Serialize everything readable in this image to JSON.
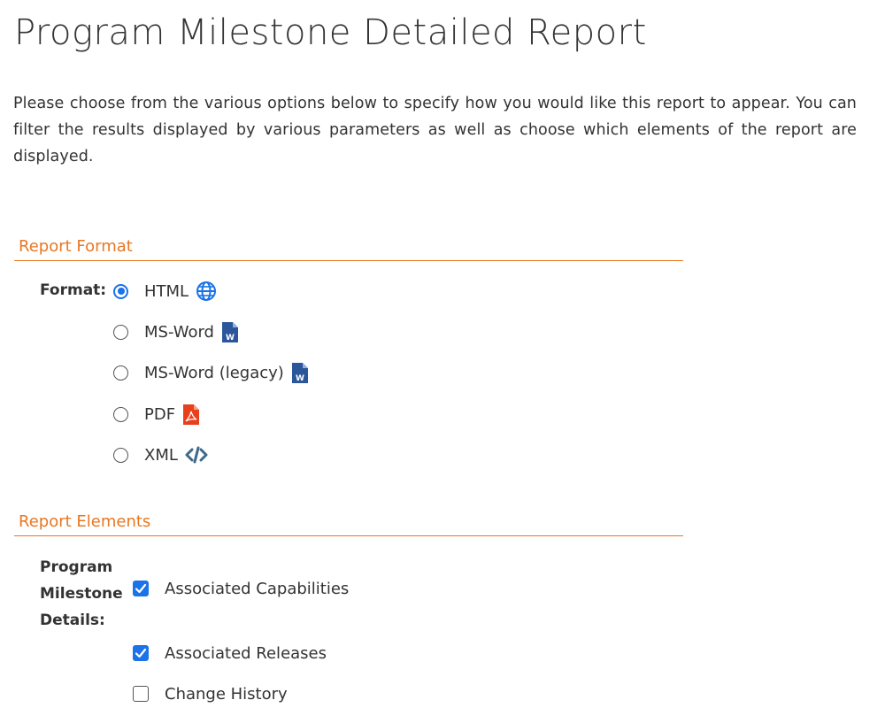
{
  "page_title": "Program Milestone Detailed Report",
  "intro": "Please choose from the various options below to specify how you would like this report to appear. You can filter the results displayed by various parameters as well as choose which elements of the report are displayed.",
  "report_format": {
    "section_title": "Report Format",
    "label": "Format:",
    "options": [
      {
        "label": "HTML",
        "icon": "globe-icon",
        "selected": true
      },
      {
        "label": "MS-Word",
        "icon": "word-icon",
        "selected": false
      },
      {
        "label": "MS-Word (legacy)",
        "icon": "word-icon",
        "selected": false
      },
      {
        "label": "PDF",
        "icon": "pdf-icon",
        "selected": false
      },
      {
        "label": "XML",
        "icon": "code-icon",
        "selected": false
      }
    ]
  },
  "report_elements": {
    "section_title": "Report Elements",
    "label_line1": "Program",
    "label_line2": "Milestone",
    "label_line3": "Details:",
    "items": [
      {
        "label": "Associated Capabilities",
        "checked": true
      },
      {
        "label": "Associated Releases",
        "checked": true
      },
      {
        "label": "Change History",
        "checked": false
      }
    ]
  },
  "colors": {
    "accent": "#e87722",
    "selection": "#1a73e8",
    "word": "#2b579a",
    "pdf": "#e8401c",
    "code": "#3d6a8a"
  }
}
